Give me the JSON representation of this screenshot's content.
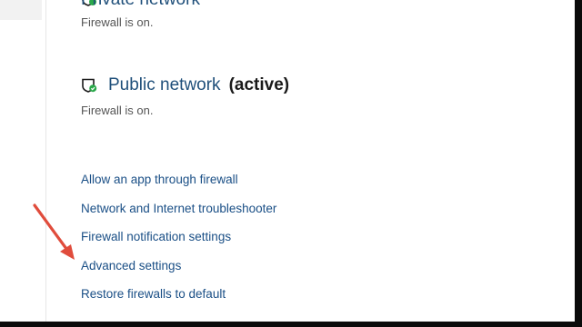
{
  "private_network": {
    "title": "Private network",
    "status": "Firewall is on."
  },
  "public_network": {
    "title": "Public network",
    "suffix": "(active)",
    "status": "Firewall is on."
  },
  "links": [
    {
      "label": "Allow an app through firewall"
    },
    {
      "label": "Network and Internet troubleshooter"
    },
    {
      "label": "Firewall notification settings"
    },
    {
      "label": "Advanced settings"
    },
    {
      "label": "Restore firewalls to default"
    }
  ],
  "colors": {
    "link": "#1a4f86",
    "heading": "#1f4f7a",
    "arrow": "#e04c3c",
    "shield_check": "#2aa84a"
  },
  "icons": [
    "shield-icon",
    "annotation-arrow"
  ]
}
